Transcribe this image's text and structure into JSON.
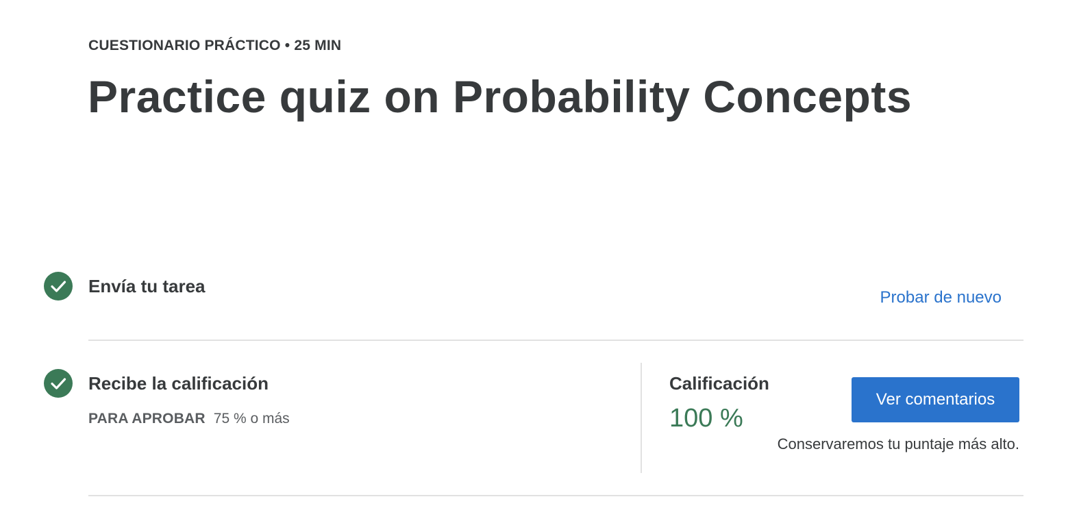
{
  "header": {
    "eyebrow": "CUESTIONARIO PRÁCTICO • 25 MIN",
    "title": "Practice quiz on Probability Concepts"
  },
  "steps": [
    {
      "title": "Envía tu tarea",
      "status_icon": "check-circle-icon",
      "completed": true,
      "action_label": "Probar de nuevo"
    },
    {
      "title": "Recibe la calificación",
      "status_icon": "check-circle-icon",
      "completed": true,
      "pass_label": "PARA APROBAR",
      "pass_value": "75 % o más"
    }
  ],
  "grade": {
    "label": "Calificación",
    "value": "100 %",
    "button_label": "Ver comentarios",
    "note": "Conservaremos tu puntaje más alto."
  },
  "colors": {
    "accent": "#2a73cc",
    "success": "#3b7a57",
    "text": "#373a3c",
    "divider": "#e1e1e1"
  }
}
